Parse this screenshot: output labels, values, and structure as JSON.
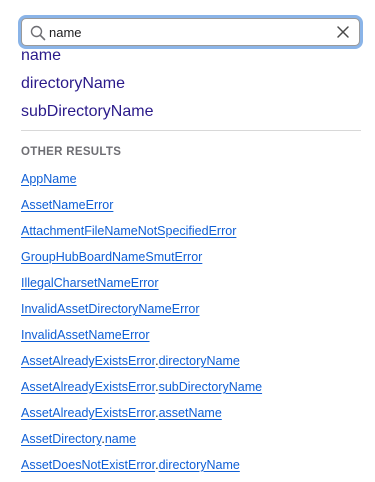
{
  "search": {
    "value": "name",
    "placeholder": ""
  },
  "top_results": [
    "name",
    "directoryName",
    "subDirectoryName"
  ],
  "section_title": "OTHER RESULTS",
  "other_results": [
    {
      "parent": "",
      "member": "AppName"
    },
    {
      "parent": "",
      "member": "AssetNameError"
    },
    {
      "parent": "",
      "member": "AttachmentFileNameNotSpecifiedError"
    },
    {
      "parent": "",
      "member": "GroupHubBoardNameSmutError"
    },
    {
      "parent": "",
      "member": "IllegalCharsetNameError"
    },
    {
      "parent": "",
      "member": "InvalidAssetDirectoryNameError"
    },
    {
      "parent": "",
      "member": "InvalidAssetNameError"
    },
    {
      "parent": "AssetAlreadyExistsError",
      "member": "directoryName"
    },
    {
      "parent": "AssetAlreadyExistsError",
      "member": "subDirectoryName"
    },
    {
      "parent": "AssetAlreadyExistsError",
      "member": "assetName"
    },
    {
      "parent": "AssetDirectory",
      "member": "name"
    },
    {
      "parent": "AssetDoesNotExistError",
      "member": "directoryName"
    }
  ],
  "icons": {
    "search": "search-icon",
    "clear": "close-icon"
  },
  "colors": {
    "top_result_link": "#2a1a8a",
    "other_result_link": "#0f5fd6",
    "focus_ring": "#8ab4e8",
    "section_title": "#6e6e73"
  }
}
